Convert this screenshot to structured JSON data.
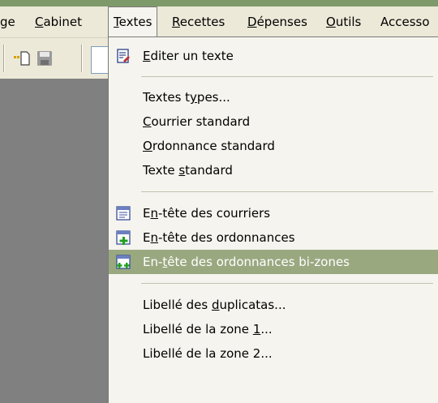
{
  "menubar": {
    "items": [
      {
        "label": "ge",
        "accel_prefix": "",
        "accel": "",
        "rest": "ge"
      },
      {
        "label": "Cabinet",
        "accel_prefix": "",
        "accel": "C",
        "rest": "abinet"
      },
      {
        "label": "Textes",
        "accel_prefix": "",
        "accel": "T",
        "rest": "extes"
      },
      {
        "label": "Recettes",
        "accel_prefix": "",
        "accel": "R",
        "rest": "ecettes"
      },
      {
        "label": "Dépenses",
        "accel_prefix": "",
        "accel": "D",
        "rest": "épenses"
      },
      {
        "label": "Outils",
        "accel_prefix": "",
        "accel": "O",
        "rest": "utils"
      },
      {
        "label": "Accesso",
        "accel_prefix": "",
        "accel": "",
        "rest": "Accesso"
      }
    ]
  },
  "menu": {
    "items": [
      {
        "pre": "",
        "accel": "E",
        "post": "diter un texte",
        "icon": "edit-text-icon"
      },
      {
        "pre": "Textes t",
        "accel": "y",
        "post": "pes...",
        "icon": ""
      },
      {
        "pre": "",
        "accel": "C",
        "post": "ourrier standard",
        "icon": ""
      },
      {
        "pre": "",
        "accel": "O",
        "post": "rdonnance standard",
        "icon": ""
      },
      {
        "pre": "Texte ",
        "accel": "s",
        "post": "tandard",
        "icon": ""
      },
      {
        "pre": "E",
        "accel": "n",
        "post": "-tête des courriers",
        "icon": "letter-header-icon"
      },
      {
        "pre": "E",
        "accel": "n",
        "post": "-tête des ordonnances",
        "icon": "prescription-header-icon"
      },
      {
        "pre": "En-",
        "accel": "t",
        "post": "ête des ordonnances bi-zones",
        "icon": "prescription-bizone-header-icon"
      },
      {
        "pre": "Libellé des ",
        "accel": "d",
        "post": "uplicatas...",
        "icon": ""
      },
      {
        "pre": "Libellé de la zone ",
        "accel": "1",
        "post": "...",
        "icon": ""
      },
      {
        "pre": "Libellé de la zone 2...",
        "accel": "",
        "post": "",
        "icon": ""
      }
    ]
  },
  "colors": {
    "highlight": "#9aa880",
    "menu_bg": "#f5f4ee",
    "workspace": "#808080",
    "frame": "#ece9d8"
  }
}
